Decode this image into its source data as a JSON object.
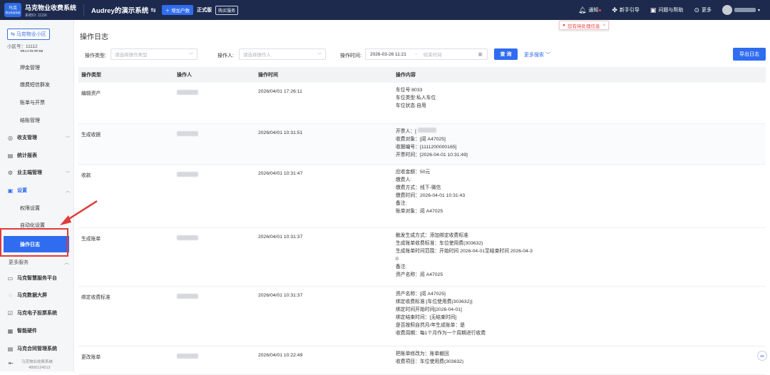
{
  "header": {
    "brand_name": "马克物业收费系统",
    "brand_sub": "系统ID: 11156",
    "logo_text_top": "马克",
    "logo_text_bottom": "物业收费系统",
    "system_name": "Audrey的演示系统",
    "add_account_label": "增加户数",
    "version_label": "正式版",
    "buy_label": "购买服务",
    "notice_label": "通知",
    "guide_label": "新手引导",
    "help_label": "问题与帮助",
    "more_label": "更多",
    "pending_tip": "您有待处理信息"
  },
  "sidebar": {
    "community_label": "马克物业小区",
    "community_no": "小区号：11112",
    "clipped_item": "押付款管理",
    "sub_items_top": [
      "押金管理",
      "缴费短信群发",
      "账单与开票",
      "结账管理"
    ],
    "groups": [
      {
        "label": "收支管理",
        "icon": "coin-icon"
      },
      {
        "label": "统计报表",
        "icon": "report-icon"
      },
      {
        "label": "业主端管理",
        "icon": "owner-icon"
      },
      {
        "label": "设置",
        "icon": "settings-icon"
      }
    ],
    "settings_sub": [
      "权限设置",
      "自动化设置",
      "操作日志"
    ],
    "more_services_label": "更多服务",
    "services": [
      {
        "label": "马克智慧服务平台",
        "icon": "platform-icon"
      },
      {
        "label": "马克数据大屏",
        "icon": "screen-icon"
      },
      {
        "label": "马克电子投票系统",
        "icon": "vote-icon"
      },
      {
        "label": "智能硬件",
        "icon": "hardware-icon"
      },
      {
        "label": "马克合同管理系统",
        "icon": "contract-icon"
      }
    ],
    "footer_line1": "马克物业收费系统",
    "footer_line2": "4806124513"
  },
  "main": {
    "title": "操作日志",
    "filters": {
      "type_label": "操作类型:",
      "type_placeholder": "请选择操作类型",
      "operator_label": "操作人:",
      "operator_placeholder": "请选择操作人",
      "time_label": "操作时间:",
      "time_start": "2026-03-26 11:21",
      "time_to": "~",
      "time_end_placeholder": "结束时间"
    },
    "query_label": "查 询",
    "more_search_label": "更多搜索",
    "export_label": "导出日志",
    "columns": [
      "操作类型",
      "操作人",
      "操作时间",
      "操作内容"
    ],
    "rows": [
      {
        "type": "编辑资产",
        "time": "2026/04/01 17:26:11",
        "content": [
          "车位号:8033",
          "车位类型:私人车位",
          "车位状态:自用"
        ]
      },
      {
        "type": "生成收据",
        "time": "2026/04/01 10:31:51",
        "content": [
          "开票人：[",
          "收费对象：[阅 A47025]",
          "收据编号：[1111200000165]",
          "开票时间：[2026-04-01 10:31:49]"
        ]
      },
      {
        "type": "收款",
        "time": "2026/04/01 10:31:47",
        "content": [
          "应收金额：50元",
          "缴费人:",
          "缴费方式：线下-微信",
          "缴费时间：2026-04-01 10:31:43",
          "备注:",
          "账单对象：阅 A47025"
        ]
      },
      {
        "type": "生成账单",
        "time": "2026/04/01 10:31:37",
        "content": [
          "触发生成方式：添加绑定收费标准",
          "生成账单收费标准：车位使用费(303632)",
          "生成账单时间范围：开始时间 2026-04-01至结束时间 2026-04-3",
          "0",
          "备注:",
          "资产名称：阅 A47025"
        ]
      },
      {
        "type": "绑定收费标准",
        "time": "2026/04/01 10:31:37",
        "content": [
          "资产名称：[阅 A47025]",
          "绑定收费标准:[车位使用费(303632)]",
          "绑定时间开始时间[2026-04-01]",
          "绑定结束时间：[无结束时间]",
          "是否按照自然月/年生成账单：是",
          "收费周期：每1个月作为一个周期进行收费"
        ]
      },
      {
        "type": "更改账单",
        "time": "2026/04/01 10:22:49",
        "content": [
          "把账单修改为：账单撤回",
          "收费项目：车位使用费(303632)"
        ]
      }
    ]
  },
  "colors": {
    "accent": "#2f6cf0",
    "topbar": "#1d2a4d",
    "highlight": "#e23a3a"
  }
}
